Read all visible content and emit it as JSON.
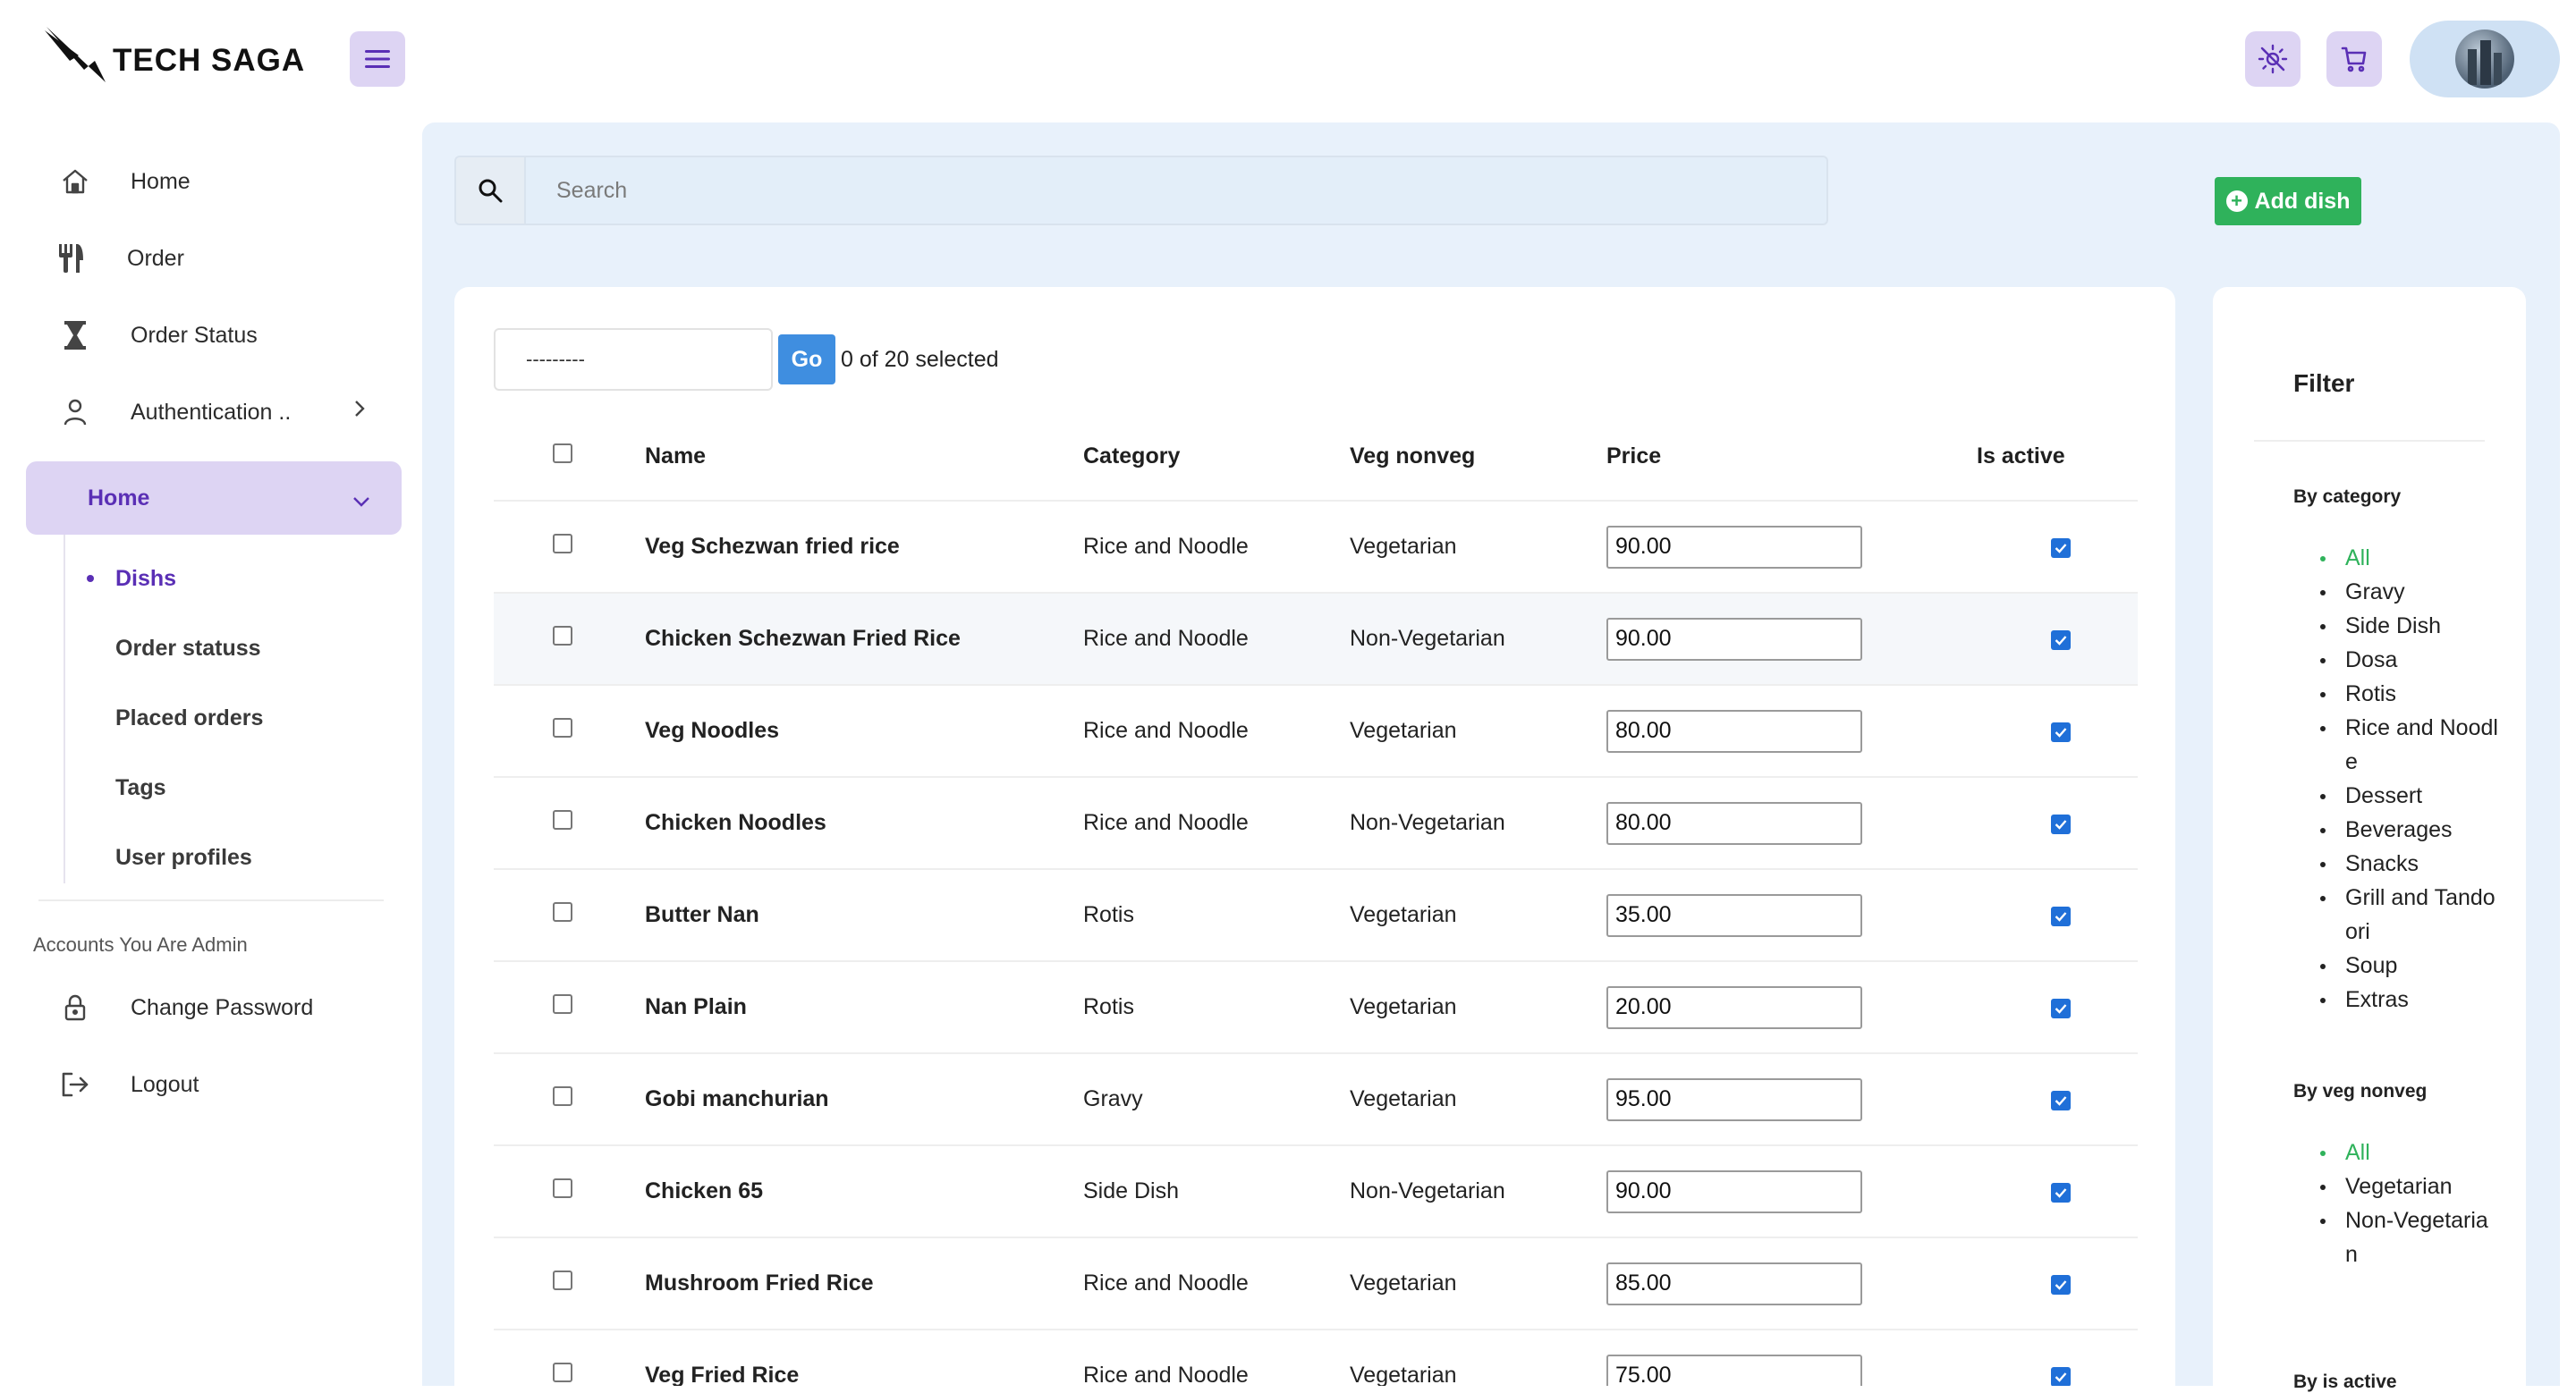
{
  "brand": {
    "name": "TECH SAGA"
  },
  "sidebar": {
    "items": [
      {
        "label": "Home",
        "icon": "home-icon"
      },
      {
        "label": "Order",
        "icon": "utensils-icon"
      },
      {
        "label": "Order Status",
        "icon": "hourglass-icon"
      },
      {
        "label": "Authentication ..",
        "icon": "user-icon"
      }
    ],
    "active_group": "Home",
    "sub_items": [
      "Dishs",
      "Order statuss",
      "Placed orders",
      "Tags",
      "User profiles"
    ],
    "section_label": "Accounts You Are Admin",
    "account_items": [
      {
        "label": "Change Password",
        "icon": "lock-icon"
      },
      {
        "label": "Logout",
        "icon": "logout-icon"
      }
    ]
  },
  "search": {
    "placeholder": "Search"
  },
  "add_button": {
    "label": "Add dish"
  },
  "actions": {
    "select_value": "---------",
    "go_label": "Go",
    "selection_text": "0 of 20 selected"
  },
  "table": {
    "headers": [
      "Name",
      "Category",
      "Veg nonveg",
      "Price",
      "Is active"
    ],
    "rows": [
      {
        "name": "Veg Schezwan fried rice",
        "category": "Rice and Noodle",
        "veg": "Vegetarian",
        "price": "90.00",
        "active": true
      },
      {
        "name": "Chicken Schezwan Fried Rice",
        "category": "Rice and Noodle",
        "veg": "Non-Vegetarian",
        "price": "90.00",
        "active": true
      },
      {
        "name": "Veg Noodles",
        "category": "Rice and Noodle",
        "veg": "Vegetarian",
        "price": "80.00",
        "active": true
      },
      {
        "name": "Chicken Noodles",
        "category": "Rice and Noodle",
        "veg": "Non-Vegetarian",
        "price": "80.00",
        "active": true
      },
      {
        "name": "Butter Nan",
        "category": "Rotis",
        "veg": "Vegetarian",
        "price": "35.00",
        "active": true
      },
      {
        "name": "Nan Plain",
        "category": "Rotis",
        "veg": "Vegetarian",
        "price": "20.00",
        "active": true
      },
      {
        "name": "Gobi manchurian",
        "category": "Gravy",
        "veg": "Vegetarian",
        "price": "95.00",
        "active": true
      },
      {
        "name": "Chicken 65",
        "category": "Side Dish",
        "veg": "Non-Vegetarian",
        "price": "90.00",
        "active": true
      },
      {
        "name": "Mushroom Fried Rice",
        "category": "Rice and Noodle",
        "veg": "Vegetarian",
        "price": "85.00",
        "active": true
      },
      {
        "name": "Veg Fried Rice",
        "category": "Rice and Noodle",
        "veg": "Vegetarian",
        "price": "75.00",
        "active": true
      }
    ]
  },
  "filter": {
    "title": "Filter",
    "by_category": {
      "label": "By category",
      "options": [
        "All",
        "Gravy",
        "Side Dish",
        "Dosa",
        "Rotis",
        "Rice and Noodle",
        "Dessert",
        "Beverages",
        "Snacks",
        "Grill and Tandoori",
        "Soup",
        "Extras"
      ]
    },
    "by_veg": {
      "label": "By veg nonveg",
      "options": [
        "All",
        "Vegetarian",
        "Non-Vegetarian"
      ]
    },
    "by_active": {
      "label": "By is active"
    }
  },
  "colors": {
    "accent": "#5a2fb5",
    "accent_bg": "#ddd4f3",
    "green": "#2fb25b",
    "main_bg": "#e8f1fb",
    "go_blue": "#3f8ee0"
  }
}
